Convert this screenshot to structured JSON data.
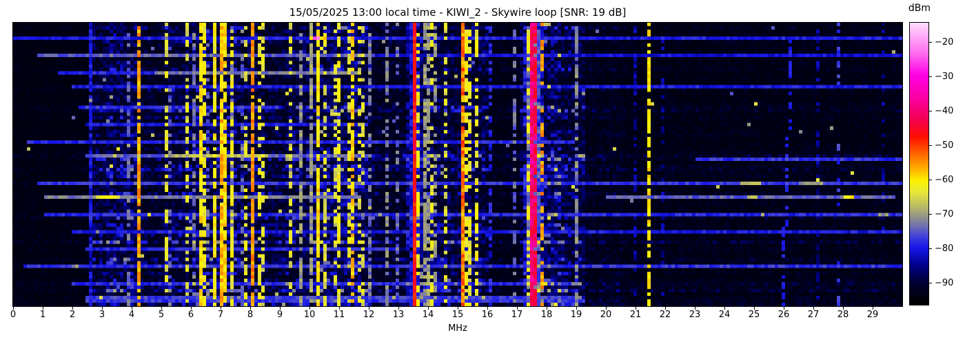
{
  "title": "15/05/2025 13:00 local time - KIWI_2 - Skywire loop [SNR: 19 dB]",
  "chart_data": {
    "type": "heatmap",
    "description": "HF spectrogram 0-30 MHz, time (vertical) vs frequency (horizontal), power in dBm",
    "xlabel": "MHz",
    "x_range": [
      0,
      30
    ],
    "x_ticks": [
      0,
      1,
      2,
      3,
      4,
      5,
      6,
      7,
      8,
      9,
      10,
      11,
      12,
      13,
      14,
      15,
      16,
      17,
      18,
      19,
      20,
      21,
      22,
      23,
      24,
      25,
      26,
      27,
      28,
      29
    ],
    "colorbar": {
      "label": "dBm",
      "range": [
        -96.5,
        -14.5
      ],
      "ticks": [
        {
          "v": -20,
          "label": "−20"
        },
        {
          "v": -30,
          "label": "−30"
        },
        {
          "v": -40,
          "label": "−40"
        },
        {
          "v": -50,
          "label": "−50"
        },
        {
          "v": -60,
          "label": "−60"
        },
        {
          "v": -70,
          "label": "−70"
        },
        {
          "v": -80,
          "label": "−80"
        },
        {
          "v": -90,
          "label": "−90"
        }
      ],
      "colormap_stops": [
        [
          0.0,
          "#000000"
        ],
        [
          0.075,
          "#000030"
        ],
        [
          0.14,
          "#00008a"
        ],
        [
          0.2,
          "#1616e8"
        ],
        [
          0.245,
          "#4444d8"
        ],
        [
          0.278,
          "#7070b0"
        ],
        [
          0.315,
          "#989884"
        ],
        [
          0.355,
          "#c0c060"
        ],
        [
          0.4,
          "#e8e838"
        ],
        [
          0.44,
          "#fdf200"
        ],
        [
          0.485,
          "#ffac00"
        ],
        [
          0.545,
          "#ff5700"
        ],
        [
          0.595,
          "#ff0f00"
        ],
        [
          0.655,
          "#f3004e"
        ],
        [
          0.735,
          "#fa00a5"
        ],
        [
          0.815,
          "#ff00e4"
        ],
        [
          0.89,
          "#ff6aef"
        ],
        [
          1.0,
          "#ffdcfc"
        ]
      ]
    },
    "bands": [
      [
        0,
        2.55,
        0.1
      ],
      [
        2.55,
        3.1,
        0.45
      ],
      [
        3.1,
        4.25,
        0.62
      ],
      [
        4.25,
        5.1,
        0.35
      ],
      [
        5.1,
        6.0,
        0.5
      ],
      [
        6.0,
        7.6,
        0.62
      ],
      [
        7.6,
        8.5,
        0.5
      ],
      [
        8.5,
        9.2,
        0.4
      ],
      [
        9.2,
        10.1,
        0.55
      ],
      [
        10.1,
        12.05,
        0.68
      ],
      [
        12.05,
        13.3,
        0.33
      ],
      [
        13.3,
        14.4,
        0.55
      ],
      [
        14.4,
        16.1,
        0.48
      ],
      [
        16.1,
        17.15,
        0.17
      ],
      [
        17.15,
        17.45,
        0.5
      ],
      [
        17.45,
        18.45,
        0.78
      ],
      [
        18.45,
        19.25,
        0.55
      ],
      [
        19.25,
        20.6,
        0.22
      ],
      [
        20.6,
        30,
        0.16
      ]
    ],
    "signals": [
      [
        2.62,
        -81,
        0.9
      ],
      [
        16.05,
        -80,
        0.55
      ],
      [
        21.02,
        -84,
        0.5
      ],
      [
        21.9,
        -85,
        0.35
      ],
      [
        27.2,
        -85,
        0.4
      ],
      [
        27.9,
        -78,
        0.3
      ],
      [
        29.35,
        -85,
        0.3
      ],
      [
        3.84,
        -74,
        0.5
      ],
      [
        5.31,
        -74,
        0.4
      ],
      [
        6.07,
        -73,
        0.45
      ],
      [
        6.58,
        -74,
        0.4
      ],
      [
        7.42,
        -73,
        0.45
      ],
      [
        7.74,
        -74,
        0.4
      ],
      [
        9.74,
        -71,
        0.7
      ],
      [
        10.07,
        -70,
        0.8
      ],
      [
        12.0,
        -73,
        0.5
      ],
      [
        12.58,
        -72,
        0.55
      ],
      [
        13.0,
        -74,
        0.4
      ],
      [
        13.85,
        -70,
        0.6
      ],
      [
        14.0,
        -70,
        0.55
      ],
      [
        14.2,
        -71,
        0.5
      ],
      [
        16.95,
        -74,
        0.45
      ],
      [
        19.0,
        -72,
        0.65
      ],
      [
        5.19,
        -64,
        0.55
      ],
      [
        5.91,
        -64,
        0.5
      ],
      [
        6.3,
        -60,
        0.85
      ],
      [
        6.42,
        -62,
        0.65
      ],
      [
        6.77,
        -61,
        0.75
      ],
      [
        7.07,
        -58,
        0.92,
        4
      ],
      [
        7.2,
        -60,
        0.8
      ],
      [
        7.35,
        -62,
        0.6
      ],
      [
        7.9,
        -64,
        0.4
      ],
      [
        8.33,
        -63,
        0.5
      ],
      [
        8.47,
        -64,
        0.4
      ],
      [
        9.4,
        -64,
        0.5
      ],
      [
        10.3,
        -60,
        0.85
      ],
      [
        10.55,
        -64,
        0.45
      ],
      [
        10.9,
        -65,
        0.35
      ],
      [
        10.95,
        -62,
        0.6
      ],
      [
        11.3,
        -64,
        0.45
      ],
      [
        11.65,
        -64,
        0.4
      ],
      [
        11.8,
        -64,
        0.35
      ],
      [
        13.7,
        -62,
        0.5
      ],
      [
        14.1,
        -63,
        0.45
      ],
      [
        14.65,
        -64,
        0.35
      ],
      [
        15.3,
        -62,
        0.6
      ],
      [
        15.45,
        -63,
        0.5
      ],
      [
        15.6,
        -62,
        0.55
      ],
      [
        17.41,
        -62,
        0.5
      ],
      [
        4.25,
        -56,
        0.85
      ],
      [
        8.05,
        -55,
        0.9
      ],
      [
        11.49,
        -58,
        0.7
      ],
      [
        15.14,
        -54,
        0.95,
        5
      ],
      [
        17.86,
        -56,
        0.45
      ],
      [
        21.45,
        -60,
        0.75,
        2
      ],
      [
        13.57,
        -47,
        0.97,
        4
      ],
      [
        17.49,
        -40,
        1.0,
        5
      ],
      [
        17.58,
        -42,
        0.95,
        5
      ]
    ],
    "drifters": [
      {
        "f0": 26.3,
        "f1": 25.95,
        "level": -80,
        "duty": 0.55
      },
      {
        "f0": 14.08,
        "f1": 13.78,
        "level": -71,
        "duty": 0.5
      }
    ],
    "bursts": [
      [
        0.05,
        0,
        30,
        -80
      ],
      [
        0.05,
        10.05,
        10.62,
        -58
      ],
      [
        0.05,
        10.12,
        10.33,
        -24
      ],
      [
        0.115,
        0.8,
        12.2,
        -75
      ],
      [
        0.115,
        12.2,
        30,
        -81
      ],
      [
        0.17,
        4.8,
        11.6,
        -73
      ],
      [
        0.17,
        1.5,
        4.8,
        -79
      ],
      [
        0.225,
        2.0,
        30,
        -80
      ],
      [
        0.3,
        2.2,
        9.0,
        -78
      ],
      [
        0.36,
        2.5,
        12.0,
        -80
      ],
      [
        0.425,
        0.5,
        19.0,
        -79
      ],
      [
        0.466,
        2.5,
        12.0,
        -75
      ],
      [
        0.466,
        5.4,
        8.6,
        -68
      ],
      [
        0.48,
        23.0,
        30,
        -78
      ],
      [
        0.563,
        0.8,
        30,
        -78
      ],
      [
        0.563,
        24.5,
        25.2,
        -69
      ],
      [
        0.563,
        26.5,
        27.3,
        -71
      ],
      [
        0.617,
        1.0,
        11.8,
        -73
      ],
      [
        0.617,
        2.8,
        3.6,
        -63
      ],
      [
        0.617,
        8.3,
        8.55,
        -64
      ],
      [
        0.617,
        20.0,
        29.8,
        -75
      ],
      [
        0.617,
        28.0,
        28.4,
        -61
      ],
      [
        0.617,
        24.8,
        25.15,
        -67
      ],
      [
        0.68,
        1.0,
        30,
        -79
      ],
      [
        0.68,
        29.15,
        29.5,
        -71
      ],
      [
        0.745,
        2.0,
        30,
        -80
      ],
      [
        0.8,
        2.5,
        13.0,
        -79
      ],
      [
        0.865,
        0.4,
        30,
        -78
      ],
      [
        0.865,
        2.0,
        2.25,
        -72
      ],
      [
        0.93,
        2.0,
        19.0,
        -79
      ],
      [
        0.975,
        2.5,
        19.0,
        -77
      ],
      [
        0.99,
        2.5,
        19.2,
        -78
      ]
    ],
    "paint": {
      "seed": 1337,
      "cols": 258,
      "rows": 82
    }
  }
}
